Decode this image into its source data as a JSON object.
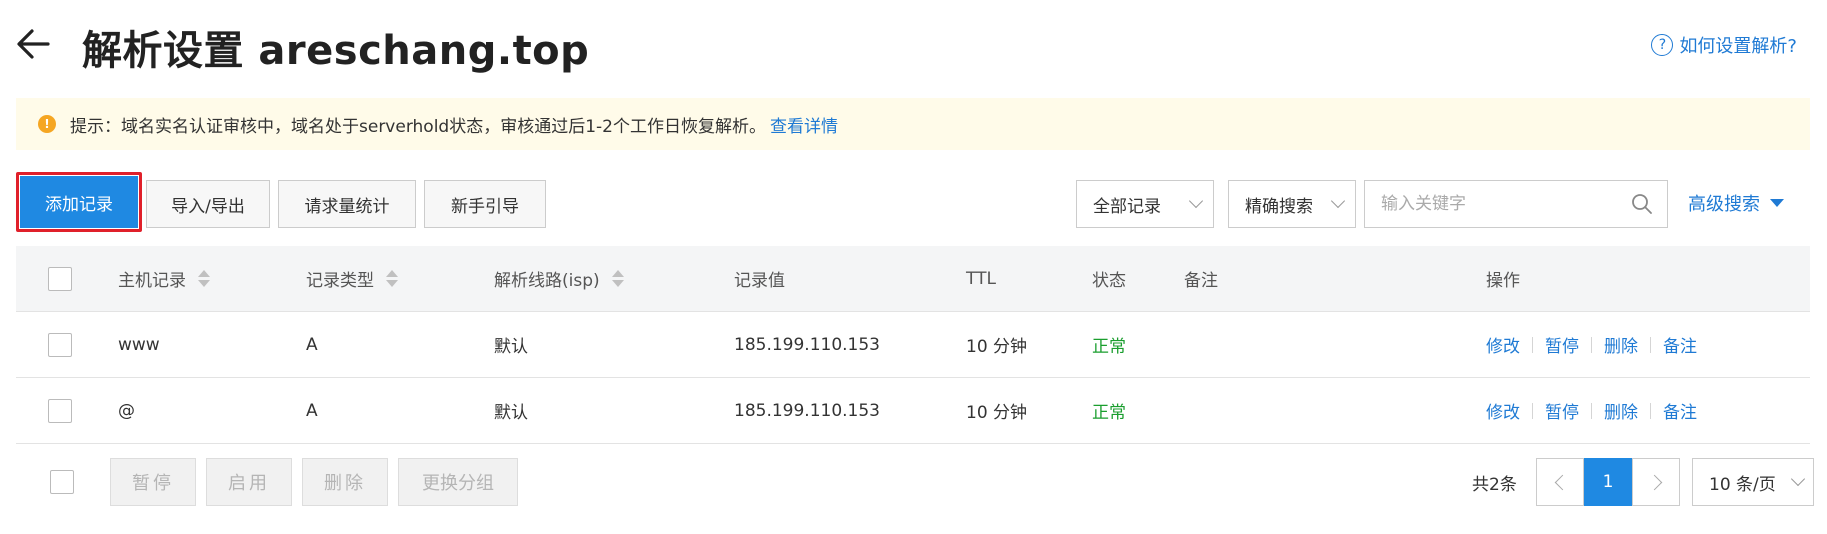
{
  "header": {
    "title": "解析设置 areschang.top",
    "help_link": "如何设置解析?",
    "help_icon": "question-circle-icon",
    "back_icon": "arrow-left-icon"
  },
  "notice": {
    "icon": "warning-icon",
    "text": "提示：域名实名认证审核中，域名处于serverhold状态，审核通过后1-2个工作日恢复解析。",
    "link": "查看详情"
  },
  "toolbar": {
    "add_record": "添加记录",
    "import_export": "导入/导出",
    "request_stats": "请求量统计",
    "newbie_guide": "新手引导",
    "record_filter": "全部记录",
    "search_mode": "精确搜索",
    "search_placeholder": "输入关键字",
    "advanced_search": "高级搜索",
    "highlight_color": "#e0202a",
    "primary_color": "#1f89e2"
  },
  "table": {
    "columns": {
      "host": "主机记录",
      "type": "记录类型",
      "line": "解析线路(isp)",
      "value": "记录值",
      "ttl": "TTL",
      "status": "状态",
      "remark": "备注",
      "actions": "操作"
    },
    "rows": [
      {
        "host": "www",
        "type": "A",
        "line": "默认",
        "value": "185.199.110.153",
        "ttl": "10 分钟",
        "status": "正常",
        "remark": ""
      },
      {
        "host": "@",
        "type": "A",
        "line": "默认",
        "value": "185.199.110.153",
        "ttl": "10 分钟",
        "status": "正常",
        "remark": ""
      }
    ],
    "actions": {
      "modify": "修改",
      "pause": "暂停",
      "delete": "删除",
      "remark": "备注"
    },
    "status_color": "#1a9e2e"
  },
  "footer": {
    "pause": "暂停",
    "enable": "启用",
    "delete": "删除",
    "change_group": "更换分组",
    "total": "共2条",
    "current_page": "1",
    "page_size": "10 条/页"
  }
}
